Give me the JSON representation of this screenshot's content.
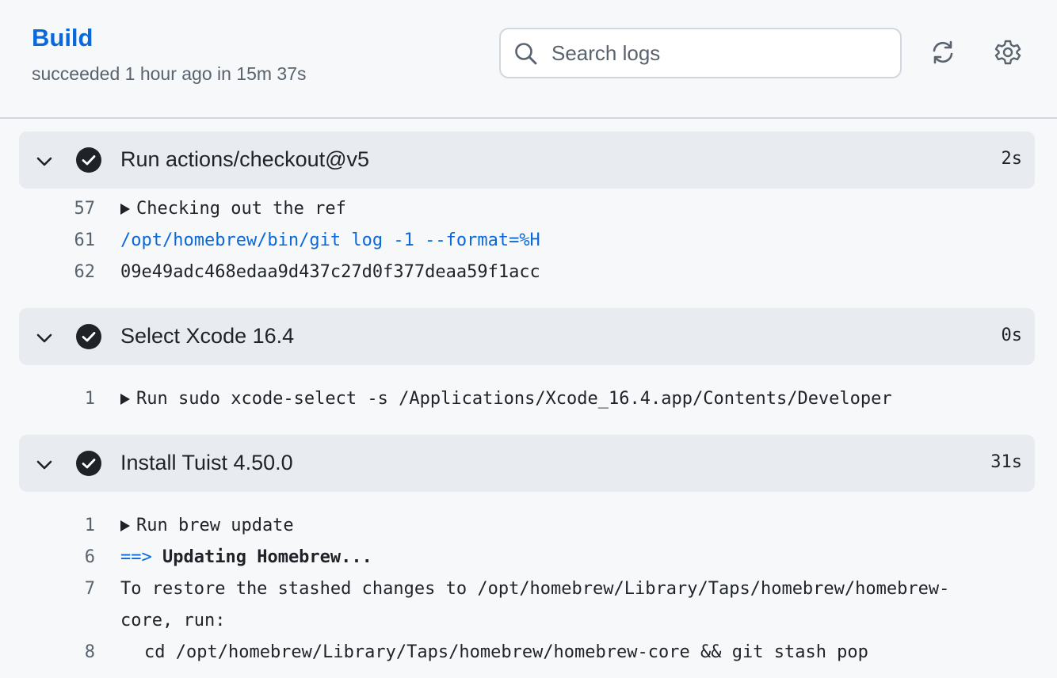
{
  "header": {
    "title": "Build",
    "status": "succeeded 1 hour ago in 15m 37s",
    "search": {
      "placeholder": "Search logs",
      "value": ""
    },
    "icons": {
      "search": "search-icon",
      "refresh": "refresh-icon",
      "settings": "gear-icon"
    }
  },
  "colors": {
    "accent": "#0969da",
    "step_header_bg": "#e8ebef",
    "page_bg": "#f6f8fa",
    "muted": "#59636e"
  },
  "steps": [
    {
      "name": "Run actions/checkout@v5",
      "duration": "2s",
      "status_icon": "check-circle-icon",
      "lines": [
        {
          "num": "57",
          "text": "Checking out the ref",
          "collapsible": true
        },
        {
          "num": "61",
          "text": "/opt/homebrew/bin/git log -1 --format=%H",
          "style": "command"
        },
        {
          "num": "62",
          "text": "09e49adc468edaa9d437c27d0f377deaa59f1acc"
        }
      ]
    },
    {
      "name": "Select Xcode 16.4",
      "duration": "0s",
      "status_icon": "check-circle-icon",
      "lines": [
        {
          "num": "1",
          "text": "Run sudo xcode-select -s /Applications/Xcode_16.4.app/Contents/Developer",
          "collapsible": true
        }
      ]
    },
    {
      "name": "Install Tuist 4.50.0",
      "duration": "31s",
      "status_icon": "check-circle-icon",
      "lines": [
        {
          "num": "1",
          "text": "Run brew update",
          "collapsible": true
        },
        {
          "num": "6",
          "prefix": "==>",
          "text": "Updating Homebrew..."
        },
        {
          "num": "7",
          "text": "To restore the stashed changes to /opt/homebrew/Library/Taps/homebrew/homebrew-",
          "continuation": "core, run:"
        },
        {
          "num": "8",
          "text": "cd /opt/homebrew/Library/Taps/homebrew/homebrew-core && git stash pop"
        }
      ]
    }
  ]
}
